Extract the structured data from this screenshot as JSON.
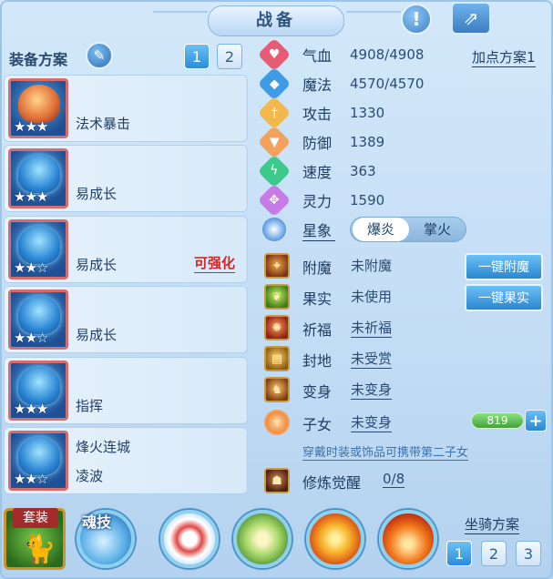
{
  "title": "战备",
  "header": {
    "help_icon": "exclamation-icon",
    "share_icon": "share-icon"
  },
  "left": {
    "scheme_label": "装备方案",
    "scheme_tabs": [
      "1",
      "2"
    ],
    "items": [
      {
        "name": "法术暴击",
        "name2": "",
        "stars": "★★★",
        "art": "orange"
      },
      {
        "name": "易成长",
        "name2": "",
        "stars": "★★★",
        "art": "blue"
      },
      {
        "name": "易成长",
        "name2": "",
        "stars": "★★☆",
        "art": "blue",
        "badge": "可强化"
      },
      {
        "name": "易成长",
        "name2": "",
        "stars": "★★☆",
        "art": "blue"
      },
      {
        "name": "指挥",
        "name2": "",
        "stars": "★★★",
        "art": "blue"
      },
      {
        "name": "烽火连城",
        "name2": "凌波",
        "stars": "★★☆",
        "art": "blue"
      }
    ]
  },
  "stats": [
    {
      "label": "气血",
      "value": "4908/4908",
      "icon": "heart-icon",
      "color": "#e85b74"
    },
    {
      "label": "魔法",
      "value": "4570/4570",
      "icon": "mana-icon",
      "color": "#3f9be6"
    },
    {
      "label": "攻击",
      "value": "1330",
      "icon": "sword-icon",
      "color": "#f2b84b"
    },
    {
      "label": "防御",
      "value": "1389",
      "icon": "shield-icon",
      "color": "#f2a25c"
    },
    {
      "label": "速度",
      "value": "363",
      "icon": "speed-icon",
      "color": "#3dc88c"
    },
    {
      "label": "灵力",
      "value": "1590",
      "icon": "spirit-icon",
      "color": "#c77be6"
    }
  ],
  "add_point_scheme": "加点方案1",
  "star_sign": {
    "label": "星象",
    "options": [
      "爆炎",
      "掌火"
    ],
    "selected": "爆炎"
  },
  "sub_stats": [
    {
      "label": "附魔",
      "value": "未附魔",
      "icon": "enchant-icon"
    },
    {
      "label": "果实",
      "value": "未使用",
      "icon": "fruit-icon"
    },
    {
      "label": "祈福",
      "value": "未祈福",
      "icon": "pray-icon"
    },
    {
      "label": "封地",
      "value": "未受赏",
      "icon": "fief-icon"
    },
    {
      "label": "变身",
      "value": "未变身",
      "icon": "transform-icon"
    },
    {
      "label": "子女",
      "value": "未变身",
      "icon": "child-icon"
    },
    {
      "label": "修炼觉醒",
      "value": "0/8",
      "icon": "cultivate-icon"
    }
  ],
  "buttons": {
    "enchant_one_click": "一键附魔",
    "fruit_one_click": "一键果实"
  },
  "child_bar_value": "819",
  "child_hint": "穿戴时装或饰品可携带第二子女",
  "bottom": {
    "suit_label": "套装",
    "soul_skill_label": "魂技",
    "mount_scheme_label": "坐骑方案",
    "mount_tabs": [
      "1",
      "2",
      "3"
    ]
  }
}
